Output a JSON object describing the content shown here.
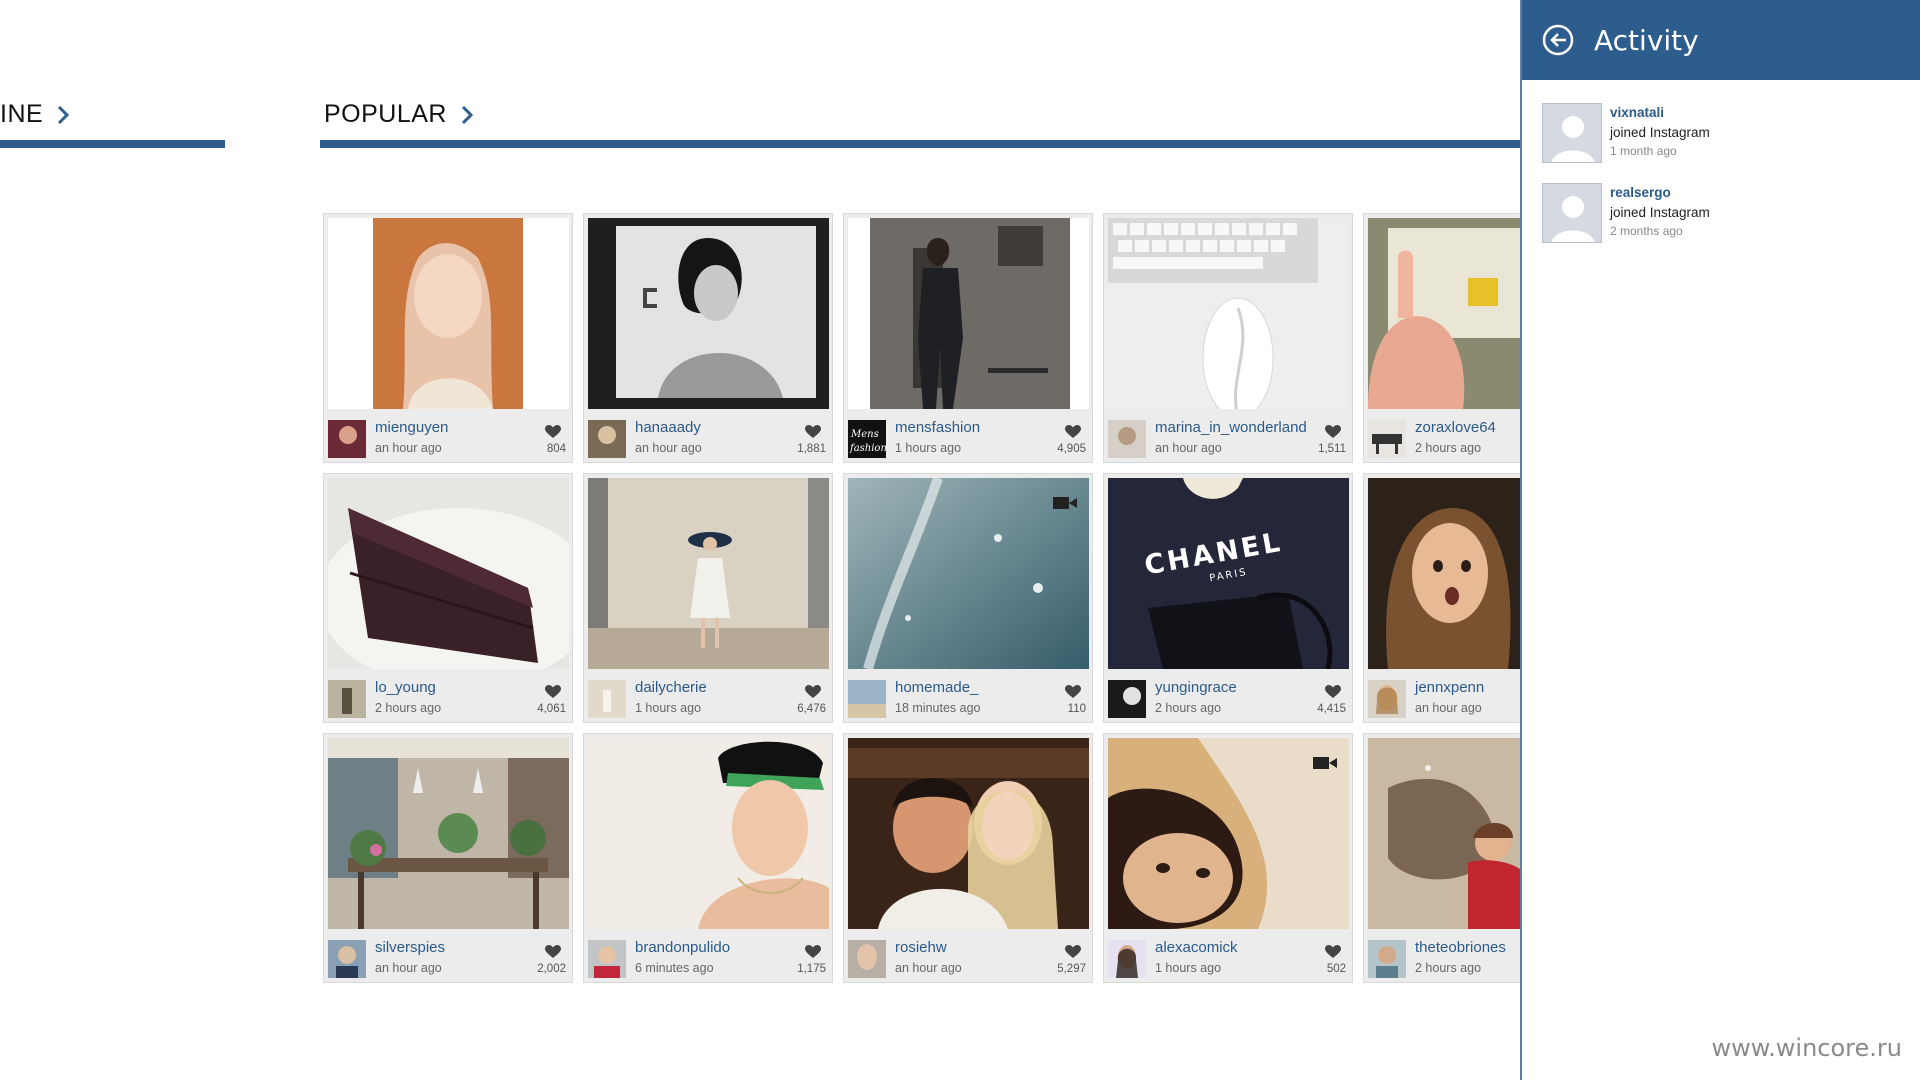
{
  "sections": {
    "left_label": "INE",
    "popular_label": "POPULAR"
  },
  "activity": {
    "title": "Activity",
    "items": [
      {
        "user": "vixnatali",
        "action": "joined Instagram",
        "time": "1 month ago"
      },
      {
        "user": "realsergo",
        "action": "joined Instagram",
        "time": "2 months ago"
      }
    ]
  },
  "posts": [
    {
      "user": "mienguyen",
      "time": "an hour ago",
      "likes": "804",
      "video": false
    },
    {
      "user": "hanaaady",
      "time": "an hour ago",
      "likes": "1,881",
      "video": false
    },
    {
      "user": "mensfashion",
      "time": "1 hours ago",
      "likes": "4,905",
      "video": false
    },
    {
      "user": "marina_in_wonderland",
      "time": "an hour ago",
      "likes": "1,511",
      "video": false
    },
    {
      "user": "zoraxlove64",
      "time": "2 hours ago",
      "likes": "",
      "video": false
    },
    {
      "user": "lo_young",
      "time": "2 hours ago",
      "likes": "4,061",
      "video": false
    },
    {
      "user": "dailycherie",
      "time": "1 hours ago",
      "likes": "6,476",
      "video": false
    },
    {
      "user": "homemade_",
      "time": "18 minutes ago",
      "likes": "110",
      "video": true
    },
    {
      "user": "yungingrace",
      "time": "2 hours ago",
      "likes": "4,415",
      "video": false
    },
    {
      "user": "jennxpenn",
      "time": "an hour ago",
      "likes": "",
      "video": false
    },
    {
      "user": "silverspies",
      "time": "an hour ago",
      "likes": "2,002",
      "video": false
    },
    {
      "user": "brandonpulido",
      "time": "6 minutes ago",
      "likes": "1,175",
      "video": false
    },
    {
      "user": "rosiehw",
      "time": "an hour ago",
      "likes": "5,297",
      "video": false
    },
    {
      "user": "alexacomick",
      "time": "1 hours ago",
      "likes": "502",
      "video": true
    },
    {
      "user": "theteobriones",
      "time": "2 hours ago",
      "likes": "",
      "video": false
    }
  ],
  "chanel_print": {
    "brand": "CHANEL",
    "city": "PARIS"
  },
  "watermark": "www.wincore.ru",
  "colors": {
    "accent": "#2c5d8c",
    "link": "#2b5a88"
  }
}
